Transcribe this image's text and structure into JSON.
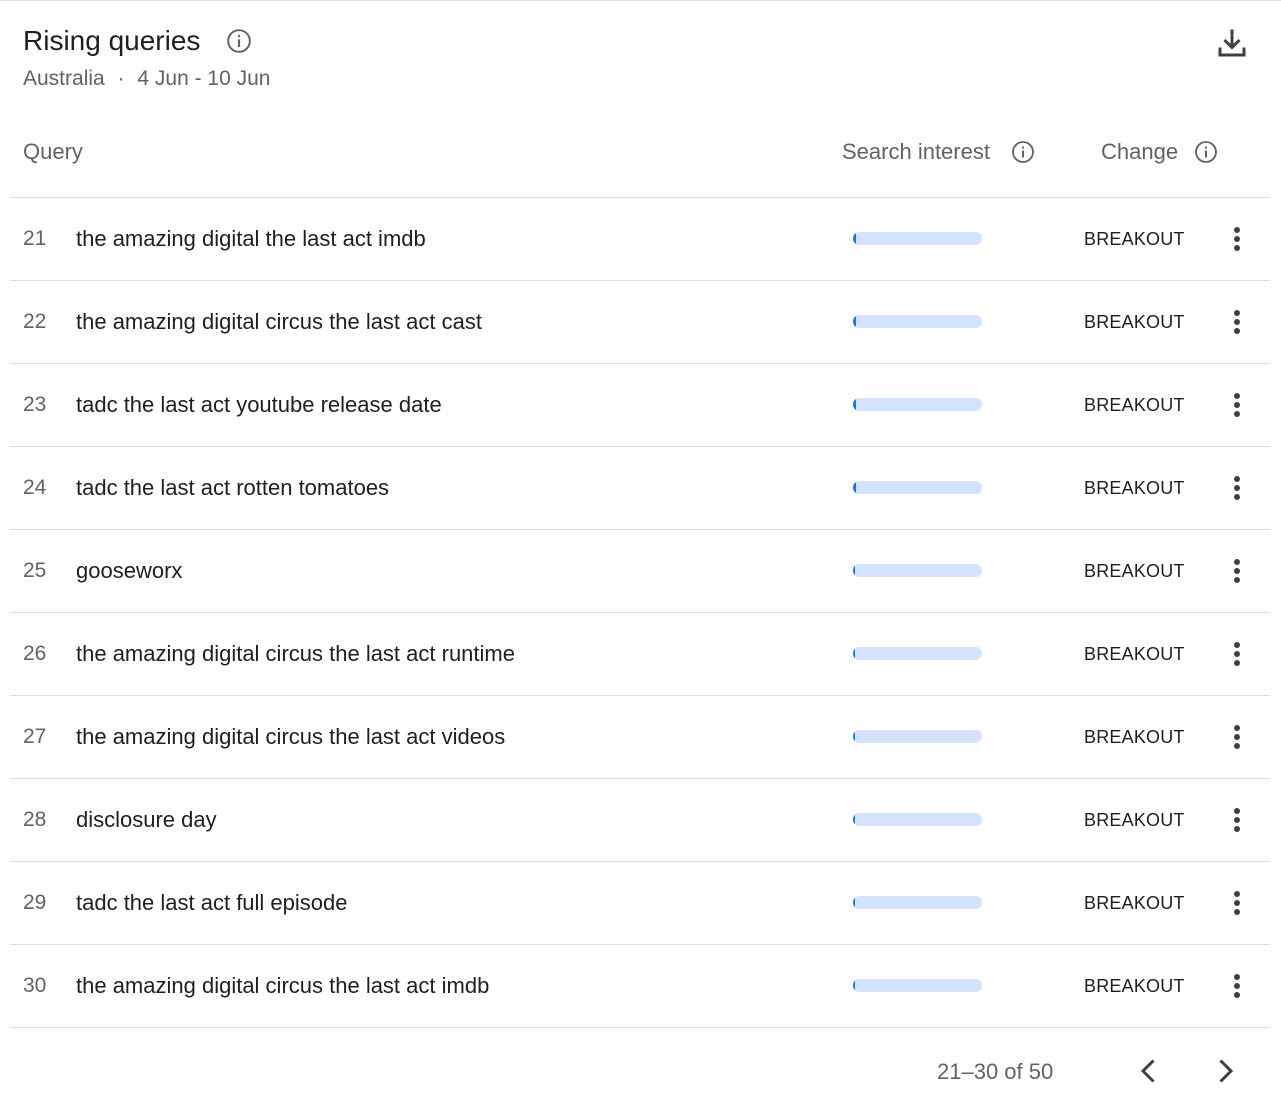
{
  "header": {
    "title": "Rising queries",
    "region": "Australia",
    "separator": "·",
    "date_range": "4 Jun - 10 Jun"
  },
  "columns": {
    "query": "Query",
    "search_interest": "Search interest",
    "change": "Change"
  },
  "rows": [
    {
      "rank": "21",
      "query": "the amazing digital the last act imdb",
      "change": "BREAKOUT",
      "interest_fill_pct": 2
    },
    {
      "rank": "22",
      "query": "the amazing digital circus the last act cast",
      "change": "BREAKOUT",
      "interest_fill_pct": 2
    },
    {
      "rank": "23",
      "query": "tadc the last act youtube release date",
      "change": "BREAKOUT",
      "interest_fill_pct": 2
    },
    {
      "rank": "24",
      "query": "tadc the last act rotten tomatoes",
      "change": "BREAKOUT",
      "interest_fill_pct": 2
    },
    {
      "rank": "25",
      "query": "gooseworx",
      "change": "BREAKOUT",
      "interest_fill_pct": 1
    },
    {
      "rank": "26",
      "query": "the amazing digital circus the last act runtime",
      "change": "BREAKOUT",
      "interest_fill_pct": 1
    },
    {
      "rank": "27",
      "query": "the amazing digital circus the last act videos",
      "change": "BREAKOUT",
      "interest_fill_pct": 1
    },
    {
      "rank": "28",
      "query": "disclosure day",
      "change": "BREAKOUT",
      "interest_fill_pct": 1
    },
    {
      "rank": "29",
      "query": "tadc the last act full episode",
      "change": "BREAKOUT",
      "interest_fill_pct": 1
    },
    {
      "rank": "30",
      "query": "the amazing digital circus the last act imdb",
      "change": "BREAKOUT",
      "interest_fill_pct": 1
    }
  ],
  "pagination": {
    "label": "21–30 of 50"
  },
  "icons": {
    "title_info": "info-icon",
    "download": "download-icon",
    "row_menu": "more-vert-icon",
    "prev": "chevron-left-icon",
    "next": "chevron-right-icon"
  },
  "colors": {
    "bar_track": "#d3e3fd",
    "bar_fill": "#1a73e8"
  }
}
